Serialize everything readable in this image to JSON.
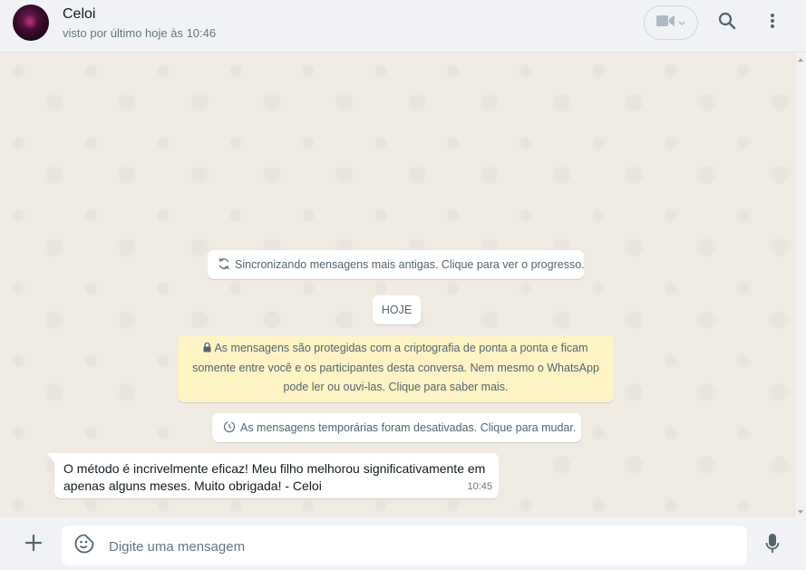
{
  "header": {
    "contact_name": "Celoi",
    "status": "visto por último hoje às 10:46",
    "icons": [
      "video-call-icon",
      "chevron-down-icon",
      "search-icon",
      "menu-icon"
    ]
  },
  "chat": {
    "sync_notice": "Sincronizando mensagens mais antigas. Clique para ver o progresso.",
    "date_label": "HOJE",
    "encryption_notice": "As mensagens são protegidas com a criptografia de ponta a ponta e ficam somente entre você e os participantes desta conversa. Nem mesmo o WhatsApp pode ler ou ouvi-las. Clique para saber mais.",
    "temporary_notice": "As mensagens temporárias foram desativadas. Clique para mudar.",
    "messages": [
      {
        "text": "O método é incrivelmente eficaz! Meu filho melhorou significativamente em apenas alguns meses. Muito obrigada! - Celoi",
        "time": "10:45",
        "direction": "incoming"
      }
    ]
  },
  "composer": {
    "placeholder": "Digite uma mensagem"
  },
  "colors": {
    "chat_background": "#efeae2",
    "header_background": "#f0f2f5",
    "encryption_background": "#fdf3c5",
    "bubble_incoming": "#ffffff"
  }
}
